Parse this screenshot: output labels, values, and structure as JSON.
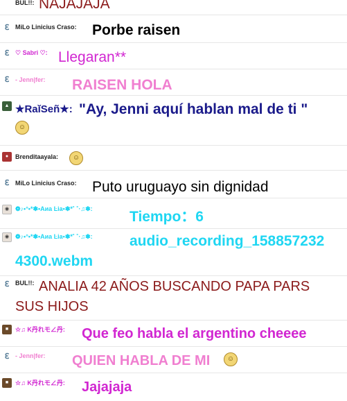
{
  "messages": [
    {
      "avatar": "user-avatar-image",
      "nick": "BUL!!:",
      "text": "NAJAJAJA",
      "color": "#8b1a1a"
    },
    {
      "avatar": "globe-icon",
      "nick": "MiLo Linicius Craso:",
      "text": "Porbe raisen",
      "color": "#000000"
    },
    {
      "avatar": "globe-icon",
      "nick": "♡ Sabri ♡:",
      "text": "Llegaran**",
      "color": "#d126d1"
    },
    {
      "avatar": "globe-icon",
      "nick": "-        Jenn|fer:",
      "text": "RAISEN HOLA",
      "color": "#f07fd0"
    },
    {
      "avatar": "user-avatar-image",
      "nick": "★RaǐSeñ★:",
      "text": "\"Ay, Jenni aquí hablan mal de ti \"",
      "color": "#1a1a8a"
    },
    {
      "avatar": "user-avatar-image",
      "nick": "Brenditaayala:",
      "text": "",
      "color": "#000000"
    },
    {
      "avatar": "globe-icon",
      "nick": "MiLo Linicius Craso:",
      "text": "Puto uruguayo sin dignidad",
      "color": "#000000"
    },
    {
      "avatar": "user-avatar-image",
      "nick": "❁♪•°•*✽•Aиa Ŀia•✽*˚ ˚·♫✽:",
      "text": "Tiempo：6",
      "color": "#1fd6f2"
    },
    {
      "avatar": "user-avatar-image",
      "nick": "❁♪•°•*✽•Aиa Ŀia•✽*˚ ˚·♫✽:",
      "text": "audio_recording_158857232",
      "text2": "4300.webm",
      "color": "#1fd6f2"
    },
    {
      "avatar": "globe-icon",
      "nick": "BUL!!:",
      "text": "ANALIA 42 AÑOS BUSCANDO PAPA PARS",
      "text2": "SUS HIJOS",
      "color": "#8b1a1a"
    },
    {
      "avatar": "user-avatar-image",
      "nick": "☆♫ K丹れモ∠丹:",
      "text": "Que feo habla el argentino cheeee",
      "color": "#d126d1"
    },
    {
      "avatar": "globe-icon",
      "nick": "-        Jenn|fer:",
      "text": "QUIEN HABLA DE MI",
      "color": "#f07fd0"
    },
    {
      "avatar": "user-avatar-image",
      "nick": "☆♫ K丹れモ∠丹:",
      "text": "Jajajaja",
      "color": "#d126d1"
    }
  ],
  "emoji": {
    "symbol": "☺"
  }
}
